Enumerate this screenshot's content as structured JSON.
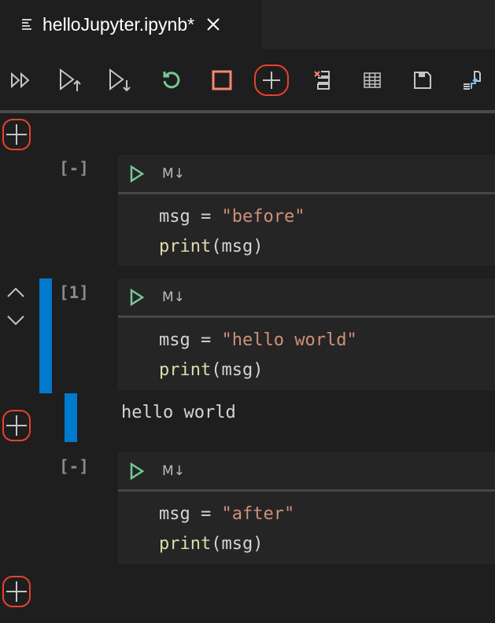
{
  "tab": {
    "title": "helloJupyter.ipynb*",
    "icon": "file-lines-icon",
    "close_icon": "close-icon"
  },
  "toolbar": [
    {
      "name": "run-all",
      "icon": "run-all-icon"
    },
    {
      "name": "run-above",
      "icon": "run-above-icon"
    },
    {
      "name": "run-below",
      "icon": "run-below-icon"
    },
    {
      "name": "restart-kernel",
      "icon": "restart-icon"
    },
    {
      "name": "interrupt-kernel",
      "icon": "stop-icon"
    },
    {
      "name": "add-cell",
      "icon": "plus-icon"
    },
    {
      "name": "clear-outputs",
      "icon": "clear-outputs-icon"
    },
    {
      "name": "variables",
      "icon": "table-icon"
    },
    {
      "name": "save",
      "icon": "save-icon"
    },
    {
      "name": "export",
      "icon": "export-icon"
    }
  ],
  "colors": {
    "accent": "#007acc",
    "highlight": "#e8412c",
    "run": "#73c991",
    "string": "#ce9178",
    "function": "#dcdcaa"
  },
  "cells": [
    {
      "exec": "[-]",
      "md": "M↓",
      "line1": {
        "var": "msg",
        "op": " = ",
        "str": "\"before\""
      },
      "line2": {
        "fn": "print",
        "args": "(msg)"
      }
    },
    {
      "exec": "[1]",
      "md": "M↓",
      "line1": {
        "var": "msg",
        "op": " = ",
        "str": "\"hello world\""
      },
      "line2": {
        "fn": "print",
        "args": "(msg)"
      },
      "output": "hello world"
    },
    {
      "exec": "[-]",
      "md": "M↓",
      "line1": {
        "var": "msg",
        "op": " = ",
        "str": "\"after\""
      },
      "line2": {
        "fn": "print",
        "args": "(msg)"
      }
    }
  ]
}
